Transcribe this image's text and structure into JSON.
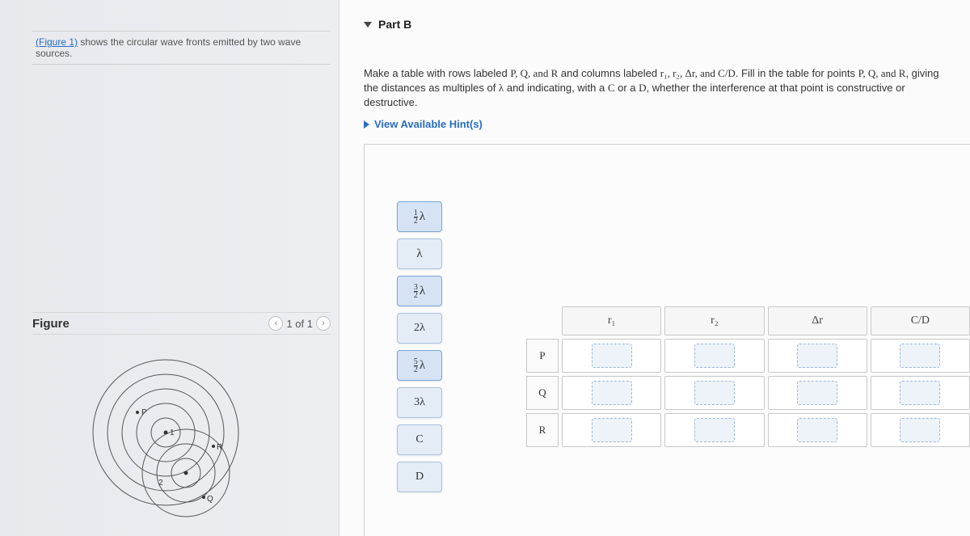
{
  "intro": {
    "link_text": "(Figure 1)",
    "text_rest": " shows the circular wave fronts emitted by two wave sources."
  },
  "figure": {
    "title": "Figure",
    "pager": "1 of 1",
    "labels": {
      "P": "P",
      "Q": "Q",
      "R": "R",
      "s1": "1",
      "s2": "2"
    }
  },
  "part": {
    "title": "Part B"
  },
  "instructions": {
    "pre": "Make a table with rows labeled ",
    "rows": "P, Q, and R",
    "mid1": " and columns labeled ",
    "cols": "r₁, r₂, Δr, and C/D",
    "mid2": ". Fill in the table for points ",
    "rows2": "P, Q, and R",
    "mid3": ", giving the distances as multiples of ",
    "lambda": "λ",
    "mid4": " and indicating, with a ",
    "C": "C",
    "or": " or a ",
    "D": "D",
    "tail": ", whether the interference at that point is constructive or destructive."
  },
  "hints_label": "View Available Hint(s)",
  "palette": {
    "items": [
      "½λ",
      "λ",
      "³⁄₂λ",
      "2λ",
      "⁵⁄₂λ",
      "3λ",
      "C",
      "D"
    ]
  },
  "table": {
    "col_headers": [
      "r₁",
      "r₂",
      "Δr",
      "C/D"
    ],
    "row_labels": [
      "P",
      "Q",
      "R"
    ]
  }
}
